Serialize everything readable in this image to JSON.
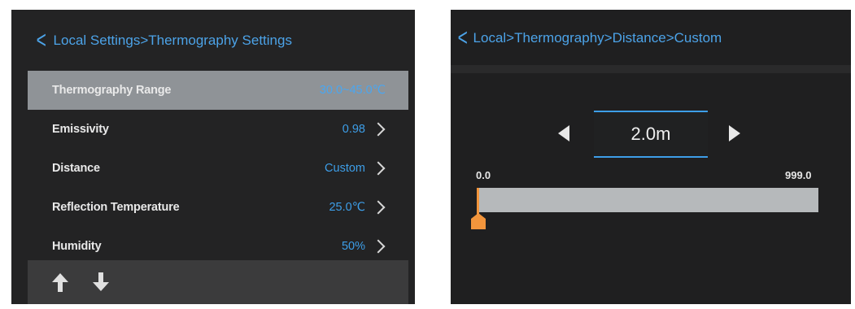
{
  "left_screen": {
    "header": {
      "back_icon": "chevron-left-icon",
      "title": "Local Settings>Thermography Settings"
    },
    "rows": [
      {
        "label": "Thermography Range",
        "value": "30.0~45.0℃",
        "selected": true,
        "has_chevron": false
      },
      {
        "label": "Emissivity",
        "value": "0.98",
        "selected": false,
        "has_chevron": true
      },
      {
        "label": "Distance",
        "value": "Custom",
        "selected": false,
        "has_chevron": true
      },
      {
        "label": "Reflection Temperature",
        "value": "25.0℃",
        "selected": false,
        "has_chevron": true
      },
      {
        "label": "Humidity",
        "value": "50%",
        "selected": false,
        "has_chevron": true
      }
    ],
    "footer": {
      "up_icon": "arrow-up-icon",
      "down_icon": "arrow-down-icon"
    }
  },
  "right_screen": {
    "header": {
      "back_icon": "chevron-left-icon",
      "title": "Local>Thermography>Distance>Custom"
    },
    "value": "2.0m",
    "range_min": "0.0",
    "range_max": "999.0",
    "slider_fraction": 0.002
  },
  "colors": {
    "accent": "#3d9ee8",
    "selected_row": "#8f9397",
    "slider_thumb": "#f2953c",
    "track": "#b6b9bb"
  }
}
